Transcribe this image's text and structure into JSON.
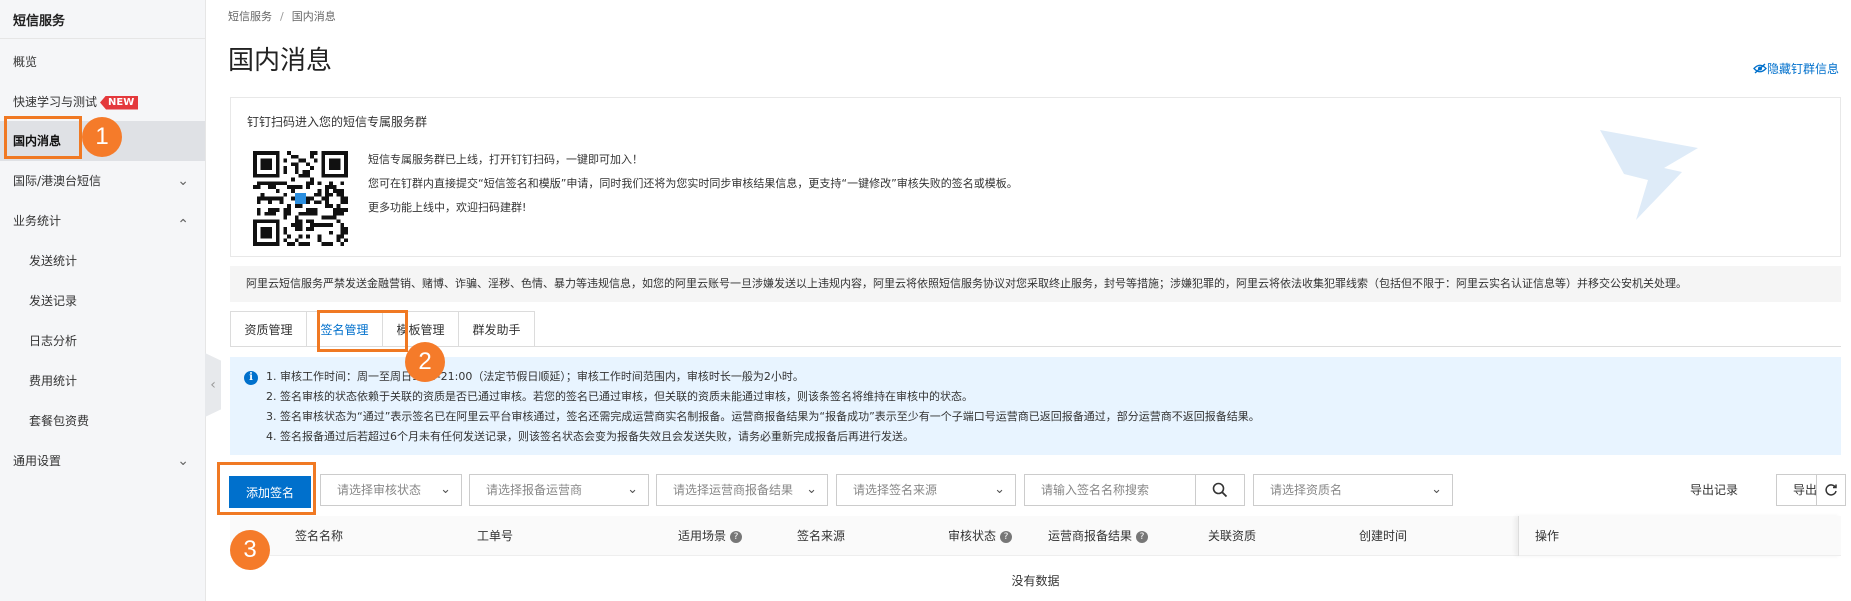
{
  "sidebar": {
    "title": "短信服务",
    "items": [
      {
        "label": "概览"
      },
      {
        "label": "快速学习与测试",
        "badge": "NEW"
      },
      {
        "label": "国内消息"
      },
      {
        "label": "国际/港澳台短信"
      },
      {
        "label": "业务统计"
      },
      {
        "label": "发送统计"
      },
      {
        "label": "发送记录"
      },
      {
        "label": "日志分析"
      },
      {
        "label": "费用统计"
      },
      {
        "label": "套餐包资费"
      },
      {
        "label": "通用设置"
      }
    ]
  },
  "breadcrumb": [
    "短信服务",
    "/",
    "国内消息"
  ],
  "page": {
    "title": "国内消息",
    "hide_link": "隐藏钉群信息"
  },
  "dingtalk": {
    "title": "钉钉扫码进入您的短信专属服务群",
    "lines": [
      "短信专属服务群已上线，打开钉钉扫码，一键即可加入！",
      "您可在钉群内直接提交“短信签名和模版”申请，同时我们还将为您实时同步审核结果信息，更支持“一键修改”审核失败的签名或模板。",
      "更多功能上线中，欢迎扫码建群!"
    ]
  },
  "warning": "阿里云短信服务严禁发送金融营销、赌博、诈骗、淫秽、色情、暴力等违规信息，如您的阿里云账号一旦涉嫌发送以上违规内容，阿里云将依照短信服务协议对您采取终止服务，封号等措施；涉嫌犯罪的，阿里云将依法收集犯罪线索（包括但不限于：阿里云实名认证信息等）并移交公安机关处理。",
  "tabs": [
    {
      "label": "资质管理"
    },
    {
      "label": "签名管理"
    },
    {
      "label": "模板管理"
    },
    {
      "label": "群发助手"
    }
  ],
  "notice": [
    "1. 审核工作时间：周一至周日9:00-21:00（法定节假日顺延）；审核工作时间范围内，审核时长一般为2小时。",
    "2. 签名审核的状态依赖于关联的资质是否已通过审核。若您的签名已通过审核，但关联的资质未能通过审核，则该条签名将维持在审核中的状态。",
    "3. 签名审核状态为“通过”表示签名已在阿里云平台审核通过，签名还需完成运营商实名制报备。运营商报备结果为“报备成功”表示至少有一个子端口号运营商已返回报备通过，部分运营商不返回报备结果。",
    "4. 签名报备通过后若超过6个月未有任何发送记录，则该签名状态会变为报备失效且会发送失败，请务必重新完成报备后再进行发送。"
  ],
  "toolbar": {
    "add_button": "添加签名",
    "status_placeholder": "请选择审核状态",
    "carrier_placeholder": "请选择报备运营商",
    "carrier_result_placeholder": "请选择运营商报备结果",
    "source_placeholder": "请选择签名来源",
    "search_placeholder": "请输入签名名称搜索",
    "qualification_placeholder": "请选择资质名",
    "export_records": "导出记录",
    "export": "导出"
  },
  "table": {
    "columns": [
      "签名名称",
      "工单号",
      "适用场景",
      "签名来源",
      "审核状态",
      "运营商报备结果",
      "关联资质",
      "创建时间",
      "操作"
    ],
    "empty_text": "没有数据"
  },
  "markers": [
    "1",
    "2",
    "3"
  ],
  "colors": {
    "primary": "#0070cc",
    "highlight": "#f07923",
    "marker": "#f57b2a",
    "new_badge": "#e4393c",
    "notice_bg": "#e8f4ff"
  }
}
